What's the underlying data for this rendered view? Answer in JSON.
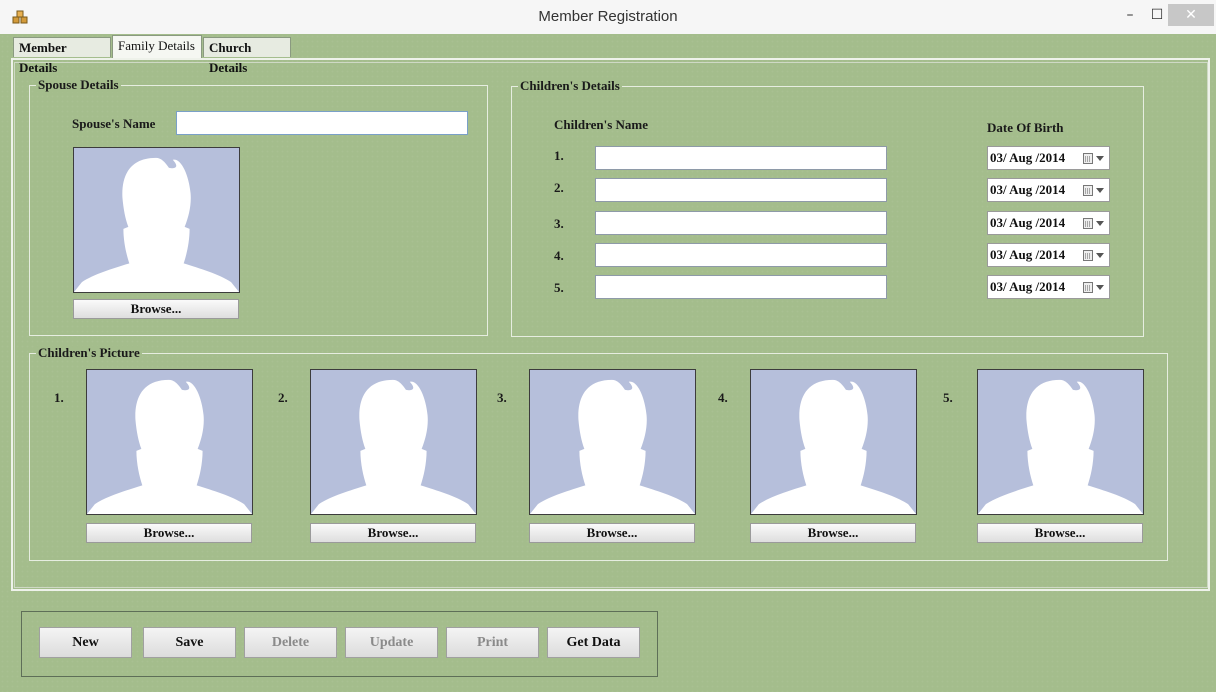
{
  "window": {
    "title": "Member Registration",
    "minimize": "–",
    "maximize": "☐",
    "close": "✕"
  },
  "tabs": [
    {
      "label": "Member Details",
      "active": false
    },
    {
      "label": "Family Details",
      "active": true
    },
    {
      "label": "Church Details",
      "active": false
    }
  ],
  "spouse": {
    "group_title": "Spouse Details",
    "name_label": "Spouse's Name",
    "name_value": "",
    "browse_label": "Browse..."
  },
  "children": {
    "group_title": "Children's Details",
    "name_header": "Children's Name",
    "dob_header": "Date Of Birth",
    "rows": [
      {
        "num": "1.",
        "name": "",
        "dob": "03/ Aug /2014"
      },
      {
        "num": "2.",
        "name": "",
        "dob": "03/ Aug /2014"
      },
      {
        "num": "3.",
        "name": "",
        "dob": "03/ Aug /2014"
      },
      {
        "num": "4.",
        "name": "",
        "dob": "03/ Aug /2014"
      },
      {
        "num": "5.",
        "name": "",
        "dob": "03/ Aug /2014"
      }
    ]
  },
  "pictures": {
    "group_title": "Children's Picture",
    "items": [
      {
        "num": "1.",
        "browse": "Browse..."
      },
      {
        "num": "2.",
        "browse": "Browse..."
      },
      {
        "num": "3.",
        "browse": "Browse..."
      },
      {
        "num": "4.",
        "browse": "Browse..."
      },
      {
        "num": "5.",
        "browse": "Browse..."
      }
    ]
  },
  "actions": [
    {
      "label": "New",
      "enabled": true
    },
    {
      "label": "Save",
      "enabled": true
    },
    {
      "label": "Delete",
      "enabled": false
    },
    {
      "label": "Update",
      "enabled": false
    },
    {
      "label": "Print",
      "enabled": false
    },
    {
      "label": "Get Data",
      "enabled": true
    }
  ],
  "colors": {
    "background": "#a4bd8c",
    "photo_bg": "#b6bfdb",
    "silhouette": "#ffffff"
  },
  "icons": {
    "app": "app-logo-icon",
    "placeholder": "person-silhouette-icon",
    "calendar": "calendar-icon"
  }
}
